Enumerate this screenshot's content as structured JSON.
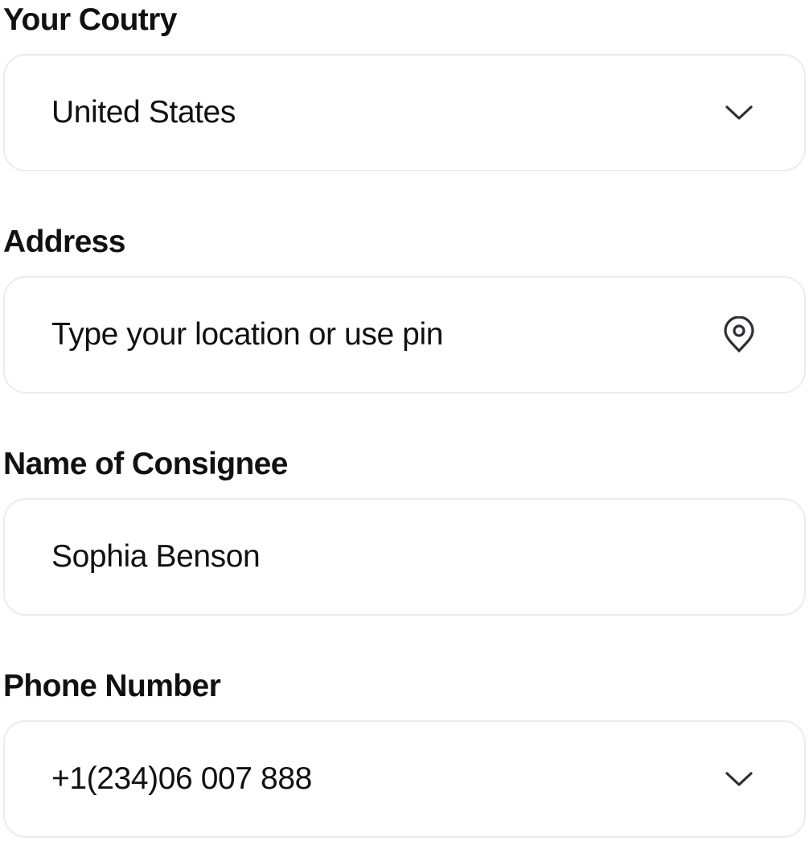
{
  "form": {
    "country": {
      "label": "Your Coutry",
      "value": "United States",
      "icon": "chevron-down-icon"
    },
    "address": {
      "label": "Address",
      "placeholder": "Type your location or use pin",
      "icon": "location-pin-icon"
    },
    "consignee": {
      "label": "Name of Consignee",
      "value": "Sophia Benson"
    },
    "phone": {
      "label": "Phone Number",
      "value": "+1(234)06 007 888",
      "icon": "chevron-down-icon"
    }
  },
  "colors": {
    "text": "#111111",
    "field_border": "#ececec",
    "icon": "#2b2f36"
  }
}
